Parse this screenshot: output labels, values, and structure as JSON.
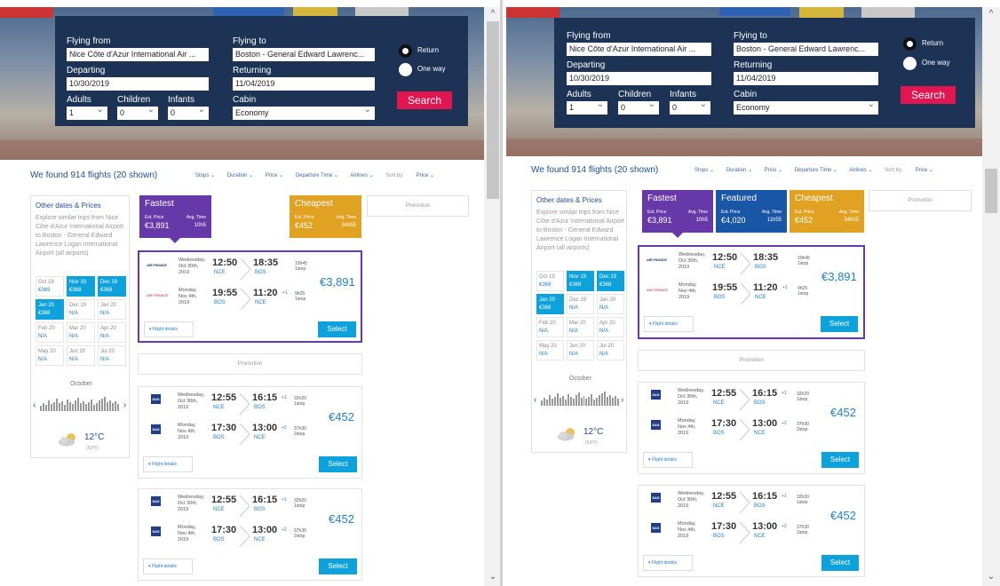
{
  "search": {
    "from_label": "Flying from",
    "from_value": "Nice Côte d'Azur International Air ...",
    "to_label": "Flying to",
    "to_value_left": "Boston - General Edward Lawrenc...",
    "to_value_right": "Boston - General Edward Lawrenc...",
    "departing_label": "Departing",
    "departing_value": "10/30/2019",
    "returning_label": "Returning",
    "returning_value": "11/04/2019",
    "adults_label": "Adults",
    "adults_value": "1",
    "children_label": "Children",
    "children_value": "0",
    "infants_label": "Infants",
    "infants_value": "0",
    "cabin_label": "Cabin",
    "cabin_value": "Economy",
    "return_label": "Return",
    "oneway_label": "One way",
    "search_label": "Search"
  },
  "results": {
    "summary": "We found 914 flights (20 shown)",
    "stops": "Stops ⌄",
    "duration": "Duration ⌄",
    "price": "Price ⌄",
    "departure": "Departure Time ⌄",
    "airlines": "Airlines ⌄",
    "sortby": "Sort by:",
    "sortval": "Price ⌄"
  },
  "sidebar": {
    "title": "Other dates & Prices",
    "text": "Explore similar trips from Nice Côte d'Azur International Airport to Boston - General Edward Lawrence Logan International Airport (all airports)",
    "cells": [
      {
        "d": "Oct 19",
        "p": "€369",
        "hl": false
      },
      {
        "d": "Nov 19",
        "p": "€368",
        "hl": true
      },
      {
        "d": "Dec 19",
        "p": "€368",
        "hl": true
      },
      {
        "d": "Jan 20",
        "p": "€368",
        "hl": true
      },
      {
        "d": "Dec 19",
        "p": "N/A",
        "hl": false
      },
      {
        "d": "Jan 20",
        "p": "N/A",
        "hl": false
      },
      {
        "d": "Feb 20",
        "p": "N/A",
        "hl": false
      },
      {
        "d": "Mar 20",
        "p": "N/A",
        "hl": false
      },
      {
        "d": "Apr 20",
        "p": "N/A",
        "hl": false
      },
      {
        "d": "May 20",
        "p": "N/A",
        "hl": false
      },
      {
        "d": "Jun 20",
        "p": "N/A",
        "hl": false
      },
      {
        "d": "Jul 20",
        "p": "N/A",
        "hl": false
      }
    ],
    "month": "October",
    "temp": "12°C",
    "temp_f": "(53°F)"
  },
  "headers": {
    "fastest": "Fastest",
    "featured": "Featured",
    "cheapest": "Cheapest",
    "est_price": "Est. Price",
    "avg_time": "Avg. Time",
    "fastest_price": "€3,891",
    "fastest_time": "10h5",
    "featured_price": "€4,020",
    "featured_time": "11h55",
    "cheapest_price": "€452",
    "cheapest_time": "34h55",
    "promotion": "Promotion"
  },
  "flights": [
    {
      "airline": "AIR FRANCE",
      "price": "€3,891",
      "legs": [
        {
          "day": "Wednesday,",
          "date": "Oct 30th,",
          "year": "2019",
          "dep": "12:50",
          "arr": "18:35",
          "from": "NCE",
          "to": "BOS",
          "plus": "",
          "dur": "10h45",
          "stops": "1stop"
        },
        {
          "day": "Monday,",
          "date": "Nov 4th,",
          "year": "2019",
          "dep": "19:55",
          "arr": "11:20",
          "from": "BOS",
          "to": "NCE",
          "plus": "+1",
          "dur": "9h25",
          "stops": "1stop"
        }
      ]
    },
    {
      "airline": "SAS",
      "price": "€452",
      "legs": [
        {
          "day": "Wednesday,",
          "date": "Oct 30th,",
          "year": "2019",
          "dep": "12:55",
          "arr": "16:15",
          "from": "NCE",
          "to": "BOS",
          "plus": "+1",
          "dur": "32h20",
          "stops": "1stop"
        },
        {
          "day": "Monday,",
          "date": "Nov 4th,",
          "year": "2019",
          "dep": "17:30",
          "arr": "13:00",
          "from": "BOS",
          "to": "NCE",
          "plus": "+2",
          "dur": "37h30",
          "stops": "2stop"
        }
      ]
    },
    {
      "airline": "SAS",
      "price": "€452",
      "legs": [
        {
          "day": "Wednesday,",
          "date": "Oct 30th,",
          "year": "2019",
          "dep": "12:55",
          "arr": "16:15",
          "from": "NCE",
          "to": "BOS",
          "plus": "+1",
          "dur": "32h20",
          "stops": "1stop"
        },
        {
          "day": "Monday,",
          "date": "Nov 4th,",
          "year": "2019",
          "dep": "17:30",
          "arr": "13:00",
          "from": "BOS",
          "to": "NCE",
          "plus": "+2",
          "dur": "37h30",
          "stops": "2stop"
        }
      ]
    }
  ],
  "buttons": {
    "details": "▾ Flight details",
    "select": "Select"
  },
  "colors": {
    "accent": "#e1154f",
    "fastest": "#6739a8",
    "featured": "#1a56a6",
    "cheapest": "#e1a222",
    "select": "#0ea2dc",
    "navy": "#1c3356"
  }
}
